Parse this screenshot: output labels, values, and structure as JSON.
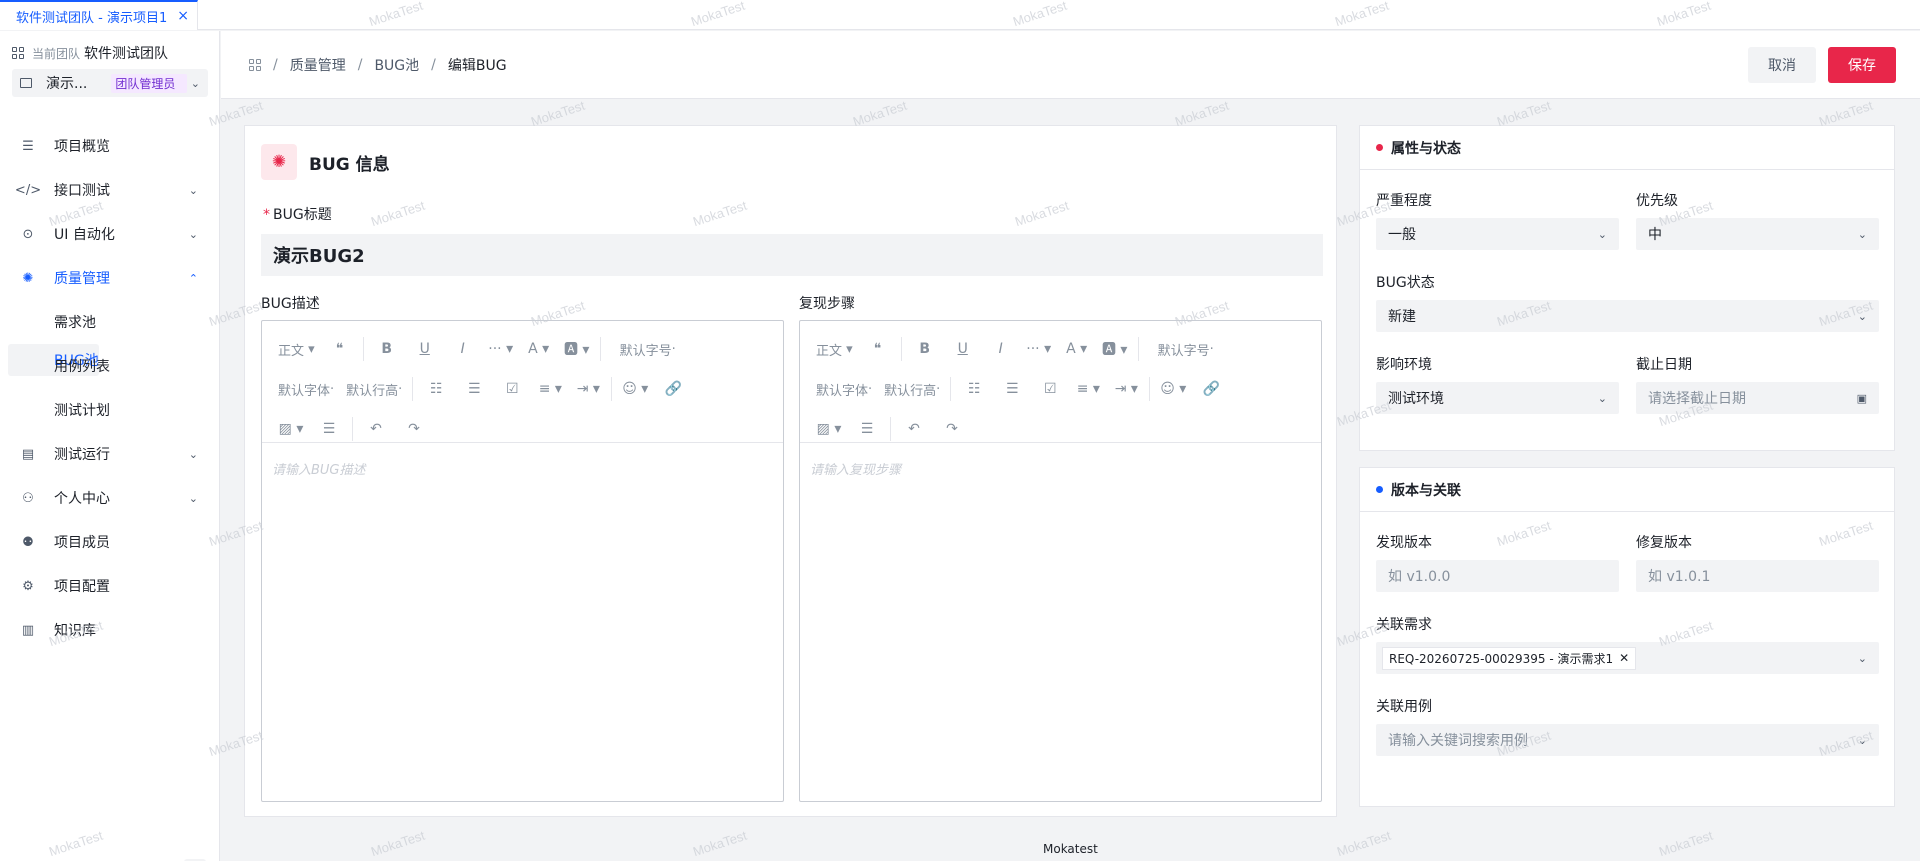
{
  "tab": {
    "label": "软件测试团队 - 演示项目1",
    "close": "×"
  },
  "sidebar": {
    "team_label": "当前团队",
    "team_name": "软件测试团队",
    "project_name": "演示...",
    "role_badge": "团队管理员",
    "menu": [
      {
        "label": "项目概览",
        "icon": "list-icon"
      },
      {
        "label": "接口测试",
        "icon": "code-icon",
        "arrow": "⌄"
      },
      {
        "label": "UI 自动化",
        "icon": "check-circle-icon",
        "arrow": "⌄"
      },
      {
        "label": "质量管理",
        "icon": "bug-icon",
        "arrow": "⌃",
        "active": true
      },
      {
        "label": "需求池",
        "sub": true
      },
      {
        "label": "BUG池",
        "sub": true,
        "selected": true
      },
      {
        "label": "用例列表",
        "sub": true
      },
      {
        "label": "测试计划",
        "sub": true
      },
      {
        "label": "测试运行",
        "icon": "run-icon",
        "arrow": "⌄"
      },
      {
        "label": "个人中心",
        "icon": "user-icon",
        "arrow": "⌄"
      },
      {
        "label": "项目成员",
        "icon": "users-icon"
      },
      {
        "label": "项目配置",
        "icon": "gear-icon"
      },
      {
        "label": "知识库",
        "icon": "book-icon"
      }
    ]
  },
  "header": {
    "breadcrumb": [
      "质量管理",
      "BUG池",
      "编辑BUG"
    ],
    "cancel_label": "取消",
    "save_label": "保存"
  },
  "bug_info": {
    "section_title": "BUG 信息",
    "title_label": "BUG标题",
    "title_required": "*",
    "title_value": "演示BUG2",
    "desc_label": "BUG描述",
    "desc_placeholder": "请输入BUG描述",
    "steps_label": "复现步骤",
    "steps_placeholder": "请输入复现步骤"
  },
  "editor_toolbar": {
    "paragraph": "正文",
    "font_size": "默认字号",
    "font_family": "默认字体",
    "line_height": "默认行高"
  },
  "props": {
    "section_title": "属性与状态",
    "severity_label": "严重程度",
    "severity_value": "一般",
    "priority_label": "优先级",
    "priority_value": "中",
    "status_label": "BUG状态",
    "status_value": "新建",
    "env_label": "影响环境",
    "env_value": "测试环境",
    "deadline_label": "截止日期",
    "deadline_placeholder": "请选择截止日期",
    "dot_color": "#e8264a"
  },
  "version": {
    "section_title": "版本与关联",
    "found_label": "发现版本",
    "found_placeholder": "如 v1.0.0",
    "fixed_label": "修复版本",
    "fixed_placeholder": "如 v1.0.1",
    "req_label": "关联需求",
    "req_tag": "REQ-20260725-00029395 - 演示需求1",
    "case_label": "关联用例",
    "case_placeholder": "请输入关键词搜索用例",
    "dot_color": "#165dff"
  },
  "footer": "Mokatest",
  "watermark": "MokaTest"
}
